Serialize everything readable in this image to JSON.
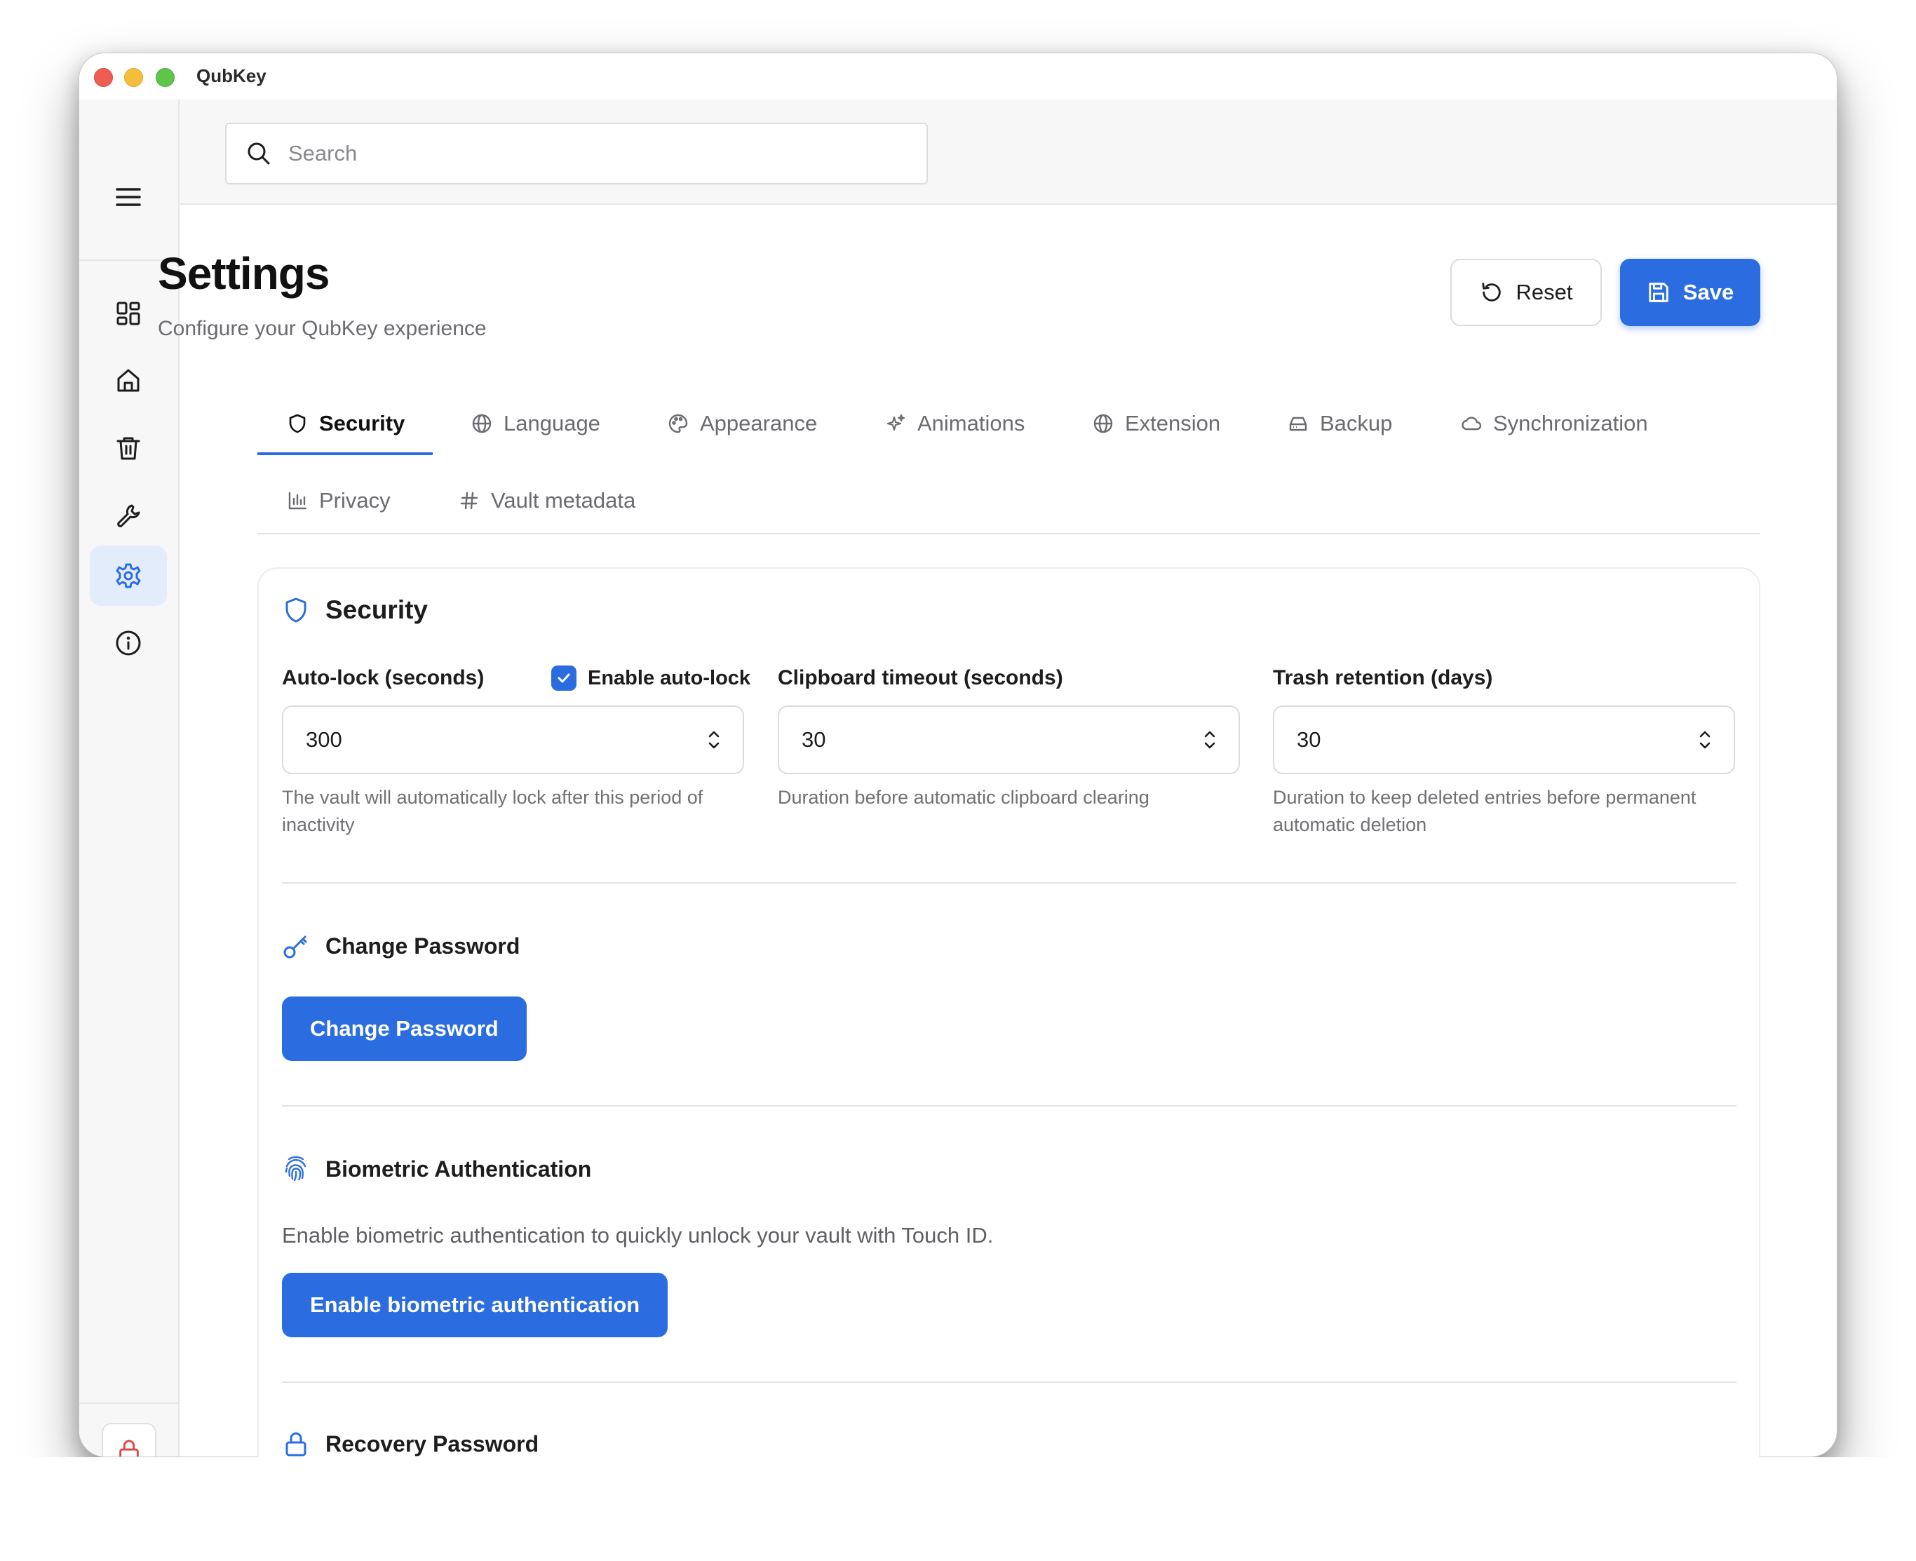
{
  "window": {
    "title": "QubKey"
  },
  "search": {
    "placeholder": "Search"
  },
  "header": {
    "title": "Settings",
    "subtitle": "Configure your QubKey experience",
    "reset_label": "Reset",
    "save_label": "Save"
  },
  "tabs": [
    {
      "label": "Security",
      "icon": "shield-icon",
      "active": true
    },
    {
      "label": "Language",
      "icon": "globe-icon"
    },
    {
      "label": "Appearance",
      "icon": "palette-icon"
    },
    {
      "label": "Animations",
      "icon": "sparkles-icon"
    },
    {
      "label": "Extension",
      "icon": "globe-icon"
    },
    {
      "label": "Backup",
      "icon": "drive-icon"
    },
    {
      "label": "Synchronization",
      "icon": "cloud-icon"
    },
    {
      "label": "Privacy",
      "icon": "bar-chart-icon"
    },
    {
      "label": "Vault metadata",
      "icon": "hash-icon"
    }
  ],
  "security": {
    "title": "Security",
    "autolock": {
      "label": "Auto-lock (seconds)",
      "checkbox_label": "Enable auto-lock",
      "checked": true,
      "value": "300",
      "help": "The vault will automatically lock after this period of inactivity"
    },
    "clipboard": {
      "label": "Clipboard timeout (seconds)",
      "value": "30",
      "help": "Duration before automatic clipboard clearing"
    },
    "trash": {
      "label": "Trash retention (days)",
      "value": "30",
      "help": "Duration to keep deleted entries before permanent automatic deletion"
    }
  },
  "change_password": {
    "title": "Change Password",
    "button_label": "Change Password"
  },
  "biometric": {
    "title": "Biometric Authentication",
    "description": "Enable biometric authentication to quickly unlock your vault with Touch ID.",
    "button_label": "Enable biometric authentication"
  },
  "recovery": {
    "title": "Recovery Password"
  },
  "colors": {
    "accent": "#2b6de1",
    "lock": "#e0463e"
  }
}
